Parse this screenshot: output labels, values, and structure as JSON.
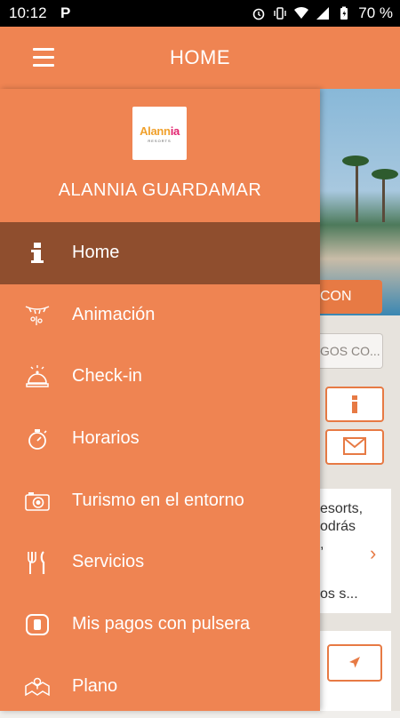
{
  "status_bar": {
    "time": "10:12",
    "app_icon": "P",
    "battery": "70 %"
  },
  "app_bar": {
    "title": "HOME"
  },
  "drawer": {
    "logo": {
      "brand": "Alannia",
      "tagline": "RESORTS"
    },
    "hotel_name": "ALANNIA GUARDAMAR",
    "items": [
      {
        "label": "Home",
        "icon": "info-icon",
        "active": true
      },
      {
        "label": "Animación",
        "icon": "party-icon",
        "active": false
      },
      {
        "label": "Check-in",
        "icon": "bell-icon",
        "active": false
      },
      {
        "label": "Horarios",
        "icon": "stopwatch-icon",
        "active": false
      },
      {
        "label": "Turismo en el entorno",
        "icon": "camera-icon",
        "active": false
      },
      {
        "label": "Servicios",
        "icon": "cutlery-icon",
        "active": false
      },
      {
        "label": "Mis pagos con pulsera",
        "icon": "wristband-icon",
        "active": false
      },
      {
        "label": "Plano",
        "icon": "map-icon",
        "active": false
      }
    ]
  },
  "background": {
    "cta_button": "CON",
    "secondary_button": "GOS CO...",
    "card_lines": [
      "esorts,",
      "odrás",
      ",",
      "os s..."
    ]
  },
  "colors": {
    "accent": "#ef8452",
    "active_item": "#8f4e2e"
  }
}
